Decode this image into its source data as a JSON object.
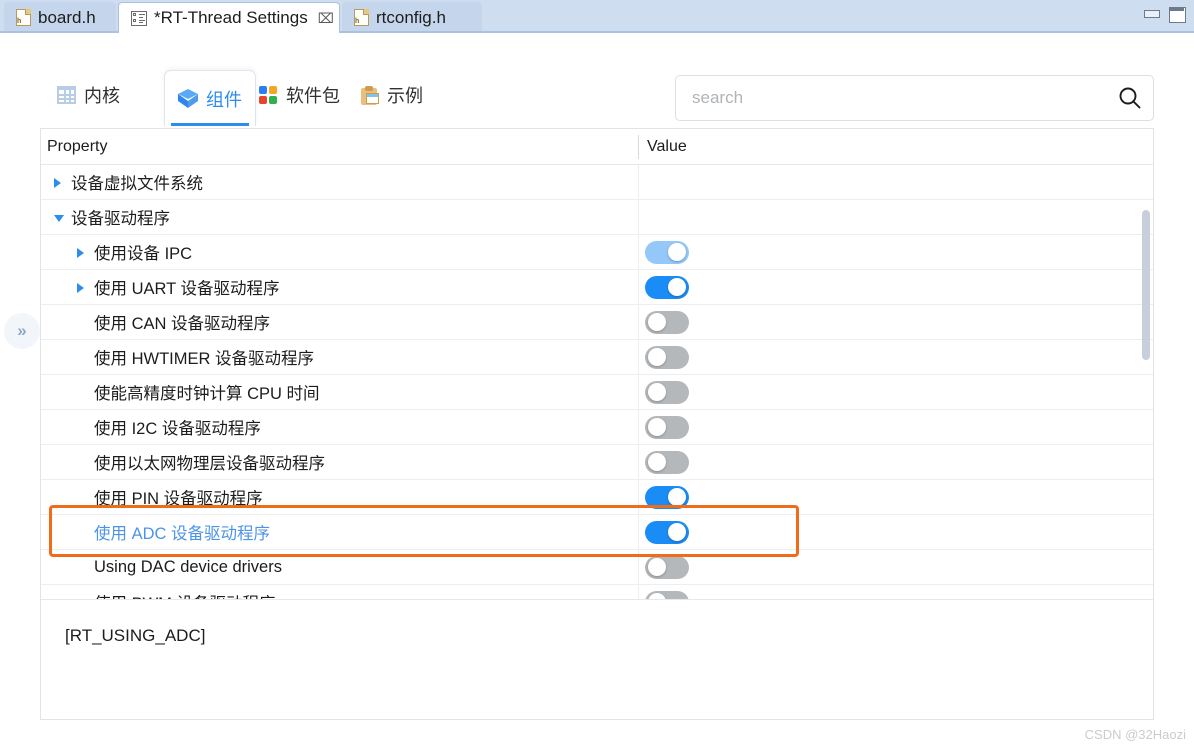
{
  "window": {
    "minimize_label": "minimize-window",
    "maximize_label": "restore-window"
  },
  "editor_tabs": [
    {
      "label": "board.h",
      "icon": "h-file-icon",
      "active": false,
      "closable": false
    },
    {
      "label": "*RT-Thread Settings",
      "icon": "settings-form-icon",
      "active": true,
      "closable": true,
      "close_glyph": "⌧"
    },
    {
      "label": "rtconfig.h",
      "icon": "h-file-icon",
      "active": false,
      "closable": false
    }
  ],
  "restore_handle": {
    "glyph": "»"
  },
  "nav_tabs": [
    {
      "label": "内核",
      "icon": "kernel-grid-icon",
      "selected": false
    },
    {
      "label": "组件",
      "icon": "component-cube-icon",
      "selected": true
    },
    {
      "label": "软件包",
      "icon": "packages-clover-icon",
      "selected": false
    },
    {
      "label": "示例",
      "icon": "demo-clipboard-icon",
      "selected": false
    }
  ],
  "search": {
    "placeholder": "search",
    "value": "",
    "icon": "search-icon"
  },
  "table": {
    "headers": {
      "property": "Property",
      "value": "Value"
    },
    "rows": [
      {
        "label": "设备虚拟文件系统",
        "level": 1,
        "arrow": "right",
        "toggle": null,
        "highlighted": false
      },
      {
        "label": "设备驱动程序",
        "level": 1,
        "arrow": "down",
        "toggle": null,
        "highlighted": false
      },
      {
        "label": "使用设备 IPC",
        "level": 2,
        "arrow": "right",
        "toggle": "dim",
        "highlighted": false
      },
      {
        "label": "使用 UART 设备驱动程序",
        "level": 2,
        "arrow": "right",
        "toggle": "on",
        "highlighted": false
      },
      {
        "label": "使用 CAN 设备驱动程序",
        "level": 2,
        "arrow": null,
        "toggle": "off",
        "highlighted": false
      },
      {
        "label": "使用 HWTIMER 设备驱动程序",
        "level": 2,
        "arrow": null,
        "toggle": "off",
        "highlighted": false
      },
      {
        "label": "使能高精度时钟计算 CPU 时间",
        "level": 2,
        "arrow": null,
        "toggle": "off",
        "highlighted": false
      },
      {
        "label": "使用 I2C 设备驱动程序",
        "level": 2,
        "arrow": null,
        "toggle": "off",
        "highlighted": false
      },
      {
        "label": "使用以太网物理层设备驱动程序",
        "level": 2,
        "arrow": null,
        "toggle": "off",
        "highlighted": false
      },
      {
        "label": "使用 PIN 设备驱动程序",
        "level": 2,
        "arrow": null,
        "toggle": "on",
        "highlighted": false
      },
      {
        "label": "使用 ADC 设备驱动程序",
        "level": 2,
        "arrow": null,
        "toggle": "on",
        "highlighted": true
      },
      {
        "label": "Using DAC device drivers",
        "level": 2,
        "arrow": null,
        "toggle": "off",
        "highlighted": false
      },
      {
        "label": "使用 PWM 设备驱动程序",
        "level": 2,
        "arrow": null,
        "toggle": "off",
        "highlighted": false
      }
    ]
  },
  "detail": {
    "text": "[RT_USING_ADC]"
  },
  "watermark": {
    "text": "CSDN @32Haozi"
  },
  "colors": {
    "accent_blue": "#2d8cf0",
    "toggle_on": "#1a8cf5",
    "toggle_dim": "#93c8f8",
    "toggle_off": "#b5b8bb",
    "highlight_orange": "#ef6c1a",
    "titlebar": "#cfddf0"
  }
}
